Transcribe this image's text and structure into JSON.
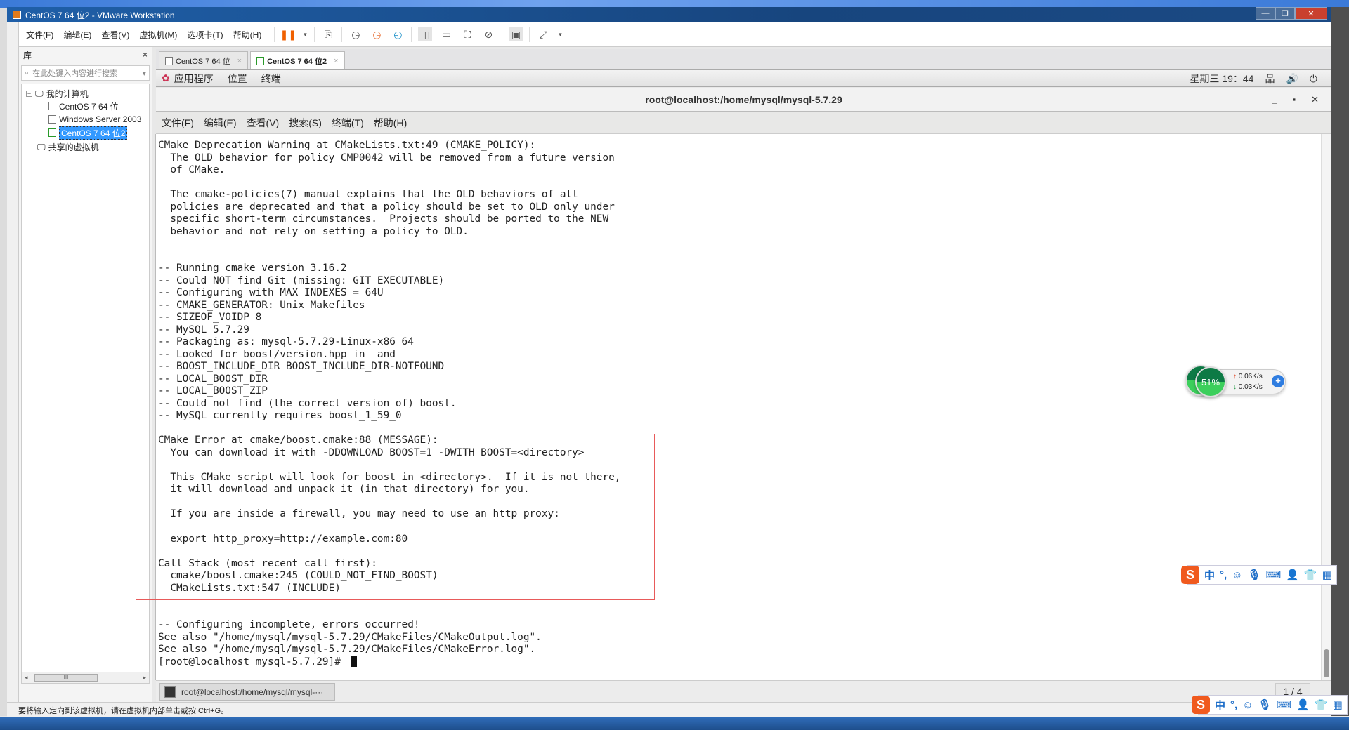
{
  "window": {
    "title": "CentOS 7 64 位2 - VMware Workstation",
    "minimize": "—",
    "restore": "❐",
    "close": "✕"
  },
  "menu": [
    "文件(F)",
    "编辑(E)",
    "查看(V)",
    "虚拟机(M)",
    "选项卡(T)",
    "帮助(H)"
  ],
  "library": {
    "title": "库",
    "close": "×",
    "search_placeholder": "在此处键入内容进行搜索",
    "tree": {
      "root": "我的计算机",
      "vms": [
        "CentOS 7 64 位",
        "Windows Server 2003",
        "CentOS 7 64 位2"
      ],
      "shared": "共享的虚拟机"
    },
    "scroll_thumb": "III"
  },
  "tabs": [
    {
      "label": "CentOS 7 64 位",
      "close": "×"
    },
    {
      "label": "CentOS 7 64 位2",
      "close": "×"
    }
  ],
  "gnome": {
    "apps": "应用程序",
    "places": "位置",
    "terminal": "终端",
    "clock": "星期三 19：44"
  },
  "terminal": {
    "title": "root@localhost:/home/mysql/mysql-5.7.29",
    "menu": [
      "文件(F)",
      "编辑(E)",
      "查看(V)",
      "搜索(S)",
      "终端(T)",
      "帮助(H)"
    ],
    "lines": [
      "CMake Deprecation Warning at CMakeLists.txt:49 (CMAKE_POLICY):",
      "  The OLD behavior for policy CMP0042 will be removed from a future version",
      "  of CMake.",
      "",
      "  The cmake-policies(7) manual explains that the OLD behaviors of all",
      "  policies are deprecated and that a policy should be set to OLD only under",
      "  specific short-term circumstances.  Projects should be ported to the NEW",
      "  behavior and not rely on setting a policy to OLD.",
      "",
      "",
      "-- Running cmake version 3.16.2",
      "-- Could NOT find Git (missing: GIT_EXECUTABLE)",
      "-- Configuring with MAX_INDEXES = 64U",
      "-- CMAKE_GENERATOR: Unix Makefiles",
      "-- SIZEOF_VOIDP 8",
      "-- MySQL 5.7.29",
      "-- Packaging as: mysql-5.7.29-Linux-x86_64",
      "-- Looked for boost/version.hpp in  and",
      "-- BOOST_INCLUDE_DIR BOOST_INCLUDE_DIR-NOTFOUND",
      "-- LOCAL_BOOST_DIR",
      "-- LOCAL_BOOST_ZIP",
      "-- Could not find (the correct version of) boost.",
      "-- MySQL currently requires boost_1_59_0",
      "",
      "CMake Error at cmake/boost.cmake:88 (MESSAGE):",
      "  You can download it with -DDOWNLOAD_BOOST=1 -DWITH_BOOST=<directory>",
      "",
      "  This CMake script will look for boost in <directory>.  If it is not there,",
      "  it will download and unpack it (in that directory) for you.",
      "",
      "  If you are inside a firewall, you may need to use an http proxy:",
      "",
      "  export http_proxy=http://example.com:80",
      "",
      "Call Stack (most recent call first):",
      "  cmake/boost.cmake:245 (COULD_NOT_FIND_BOOST)",
      "  CMakeLists.txt:547 (INCLUDE)",
      "",
      "",
      "-- Configuring incomplete, errors occurred!",
      "See also \"/home/mysql/mysql-5.7.29/CMakeFiles/CMakeOutput.log\".",
      "See also \"/home/mysql/mysql-5.7.29/CMakeFiles/CMakeError.log\"."
    ],
    "prompt": "[root@localhost mysql-5.7.29]# "
  },
  "vm_taskbar": {
    "item": "root@localhost:/home/mysql/mysql-···",
    "pager": "1 / 4"
  },
  "statusbar": "要将输入定向到该虚拟机，请在虚拟机内部单击或按 Ctrl+G。",
  "net_widget": {
    "mem_back": "34",
    "cpu": "51%",
    "up": "0.06K/s",
    "down": "0.03K/s",
    "up_arrow": "↑",
    "down_arrow": "↓",
    "plus": "+"
  },
  "ime": {
    "logo": "S",
    "mode": "中",
    "punct": "°,"
  },
  "colors": {
    "highlight_box": "#e85a5a",
    "selection": "#3399ff"
  }
}
